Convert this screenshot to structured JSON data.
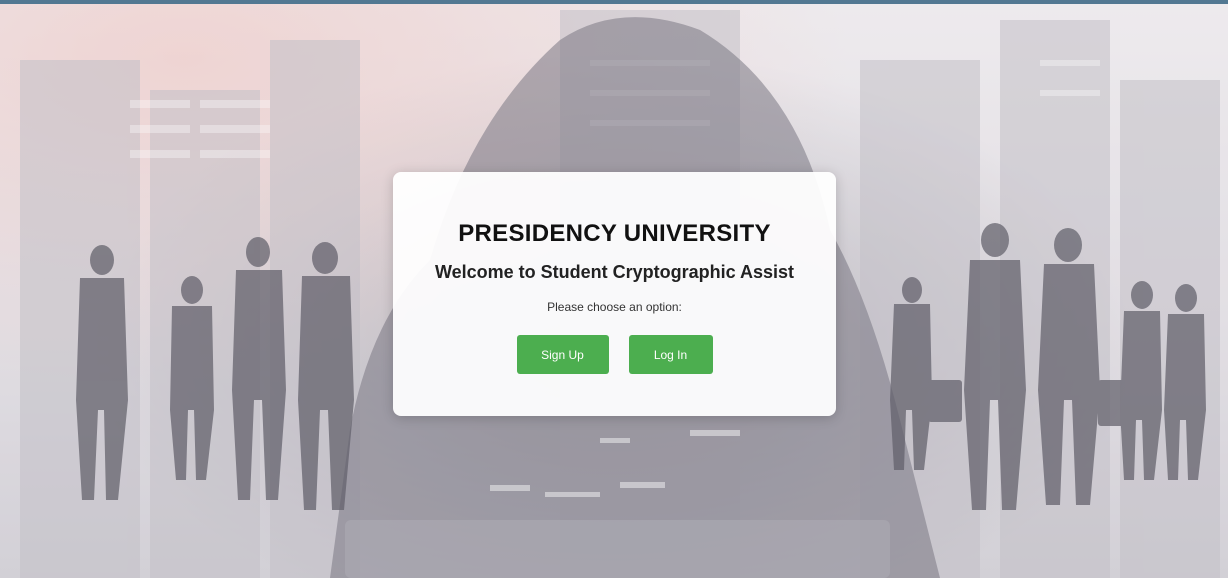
{
  "brand": {
    "accent_color": "#2d5b7a",
    "button_color": "#4cae4f"
  },
  "card": {
    "title": "PRESIDENCY UNIVERSITY",
    "subtitle": "Welcome to Student Cryptographic Assist",
    "prompt": "Please choose an option:",
    "signup_label": "Sign Up",
    "login_label": "Log In"
  }
}
